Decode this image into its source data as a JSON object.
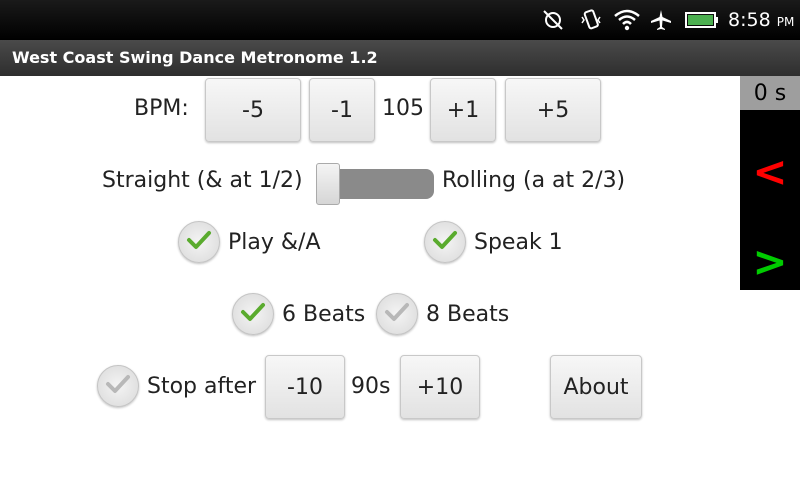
{
  "status_bar": {
    "time": "8:58",
    "ampm": "PM",
    "icons": [
      "sync-off-icon",
      "vibrate-icon",
      "wifi-icon",
      "airplane-icon",
      "battery-icon"
    ],
    "battery_color": "#4caf50"
  },
  "app": {
    "title": "West Coast Swing Dance Metronome 1.2"
  },
  "bpm": {
    "label": "BPM:",
    "minus5": "-5",
    "minus1": "-1",
    "value": "105",
    "plus1": "+1",
    "plus5": "+5"
  },
  "feel": {
    "left_label": "Straight (& at 1/2)",
    "right_label": "Rolling (a at 2/3)",
    "slider_value": 0
  },
  "options": {
    "play_label": "Play &/A",
    "play_checked": true,
    "speak_label": "Speak 1",
    "speak_checked": true,
    "six_label": "6 Beats",
    "six_checked": true,
    "eight_label": "8 Beats",
    "eight_checked": false,
    "stop_label": "Stop after",
    "stop_checked": false
  },
  "stop": {
    "minus10": "-10",
    "value": "90s",
    "plus10": "+10"
  },
  "about_label": "About",
  "side_panel": {
    "timer": "0 s",
    "prev_label": "<",
    "next_label": ">",
    "prev_color": "#ff0000",
    "next_color": "#00cc00"
  }
}
